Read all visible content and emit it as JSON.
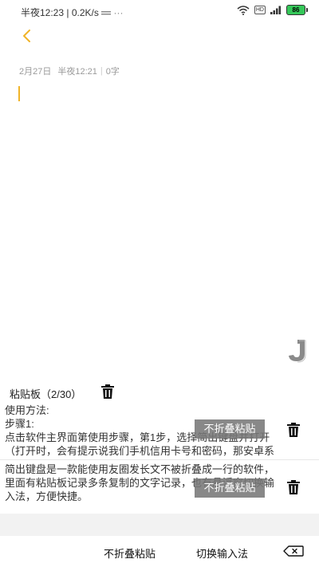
{
  "status_bar": {
    "time": "半夜12:23",
    "speed": "0.2K/s",
    "hd": "HD",
    "battery": "86"
  },
  "note": {
    "date": "2月27日",
    "time": "半夜12:21",
    "word_count": "0字"
  },
  "clipboard": {
    "title": "粘贴板（2/30）",
    "items": [
      {
        "line1": "使用方法:",
        "line2": "步骤1:",
        "line3": "点击软件主界面第使用步骤，第1步，选择简出键盘并打开",
        "line4": "（打开时，会有提示说我们手机信用卡号和密码，那安卓系",
        "button": "不折叠粘贴"
      },
      {
        "line1": "简出键盘是一款能使用友圈发长文不被折叠成一行的软件，",
        "line2": "里面有粘贴板记录多条复制的文字记录，也有悬浮窗切换输",
        "line3": "入法，方便快捷。",
        "button": "不折叠粘贴"
      }
    ]
  },
  "bottom_bar": {
    "no_fold_paste": "不折叠粘贴",
    "switch_ime": "切换输入法"
  },
  "colors": {
    "accent": "#f0b429",
    "battery": "#35c759"
  }
}
